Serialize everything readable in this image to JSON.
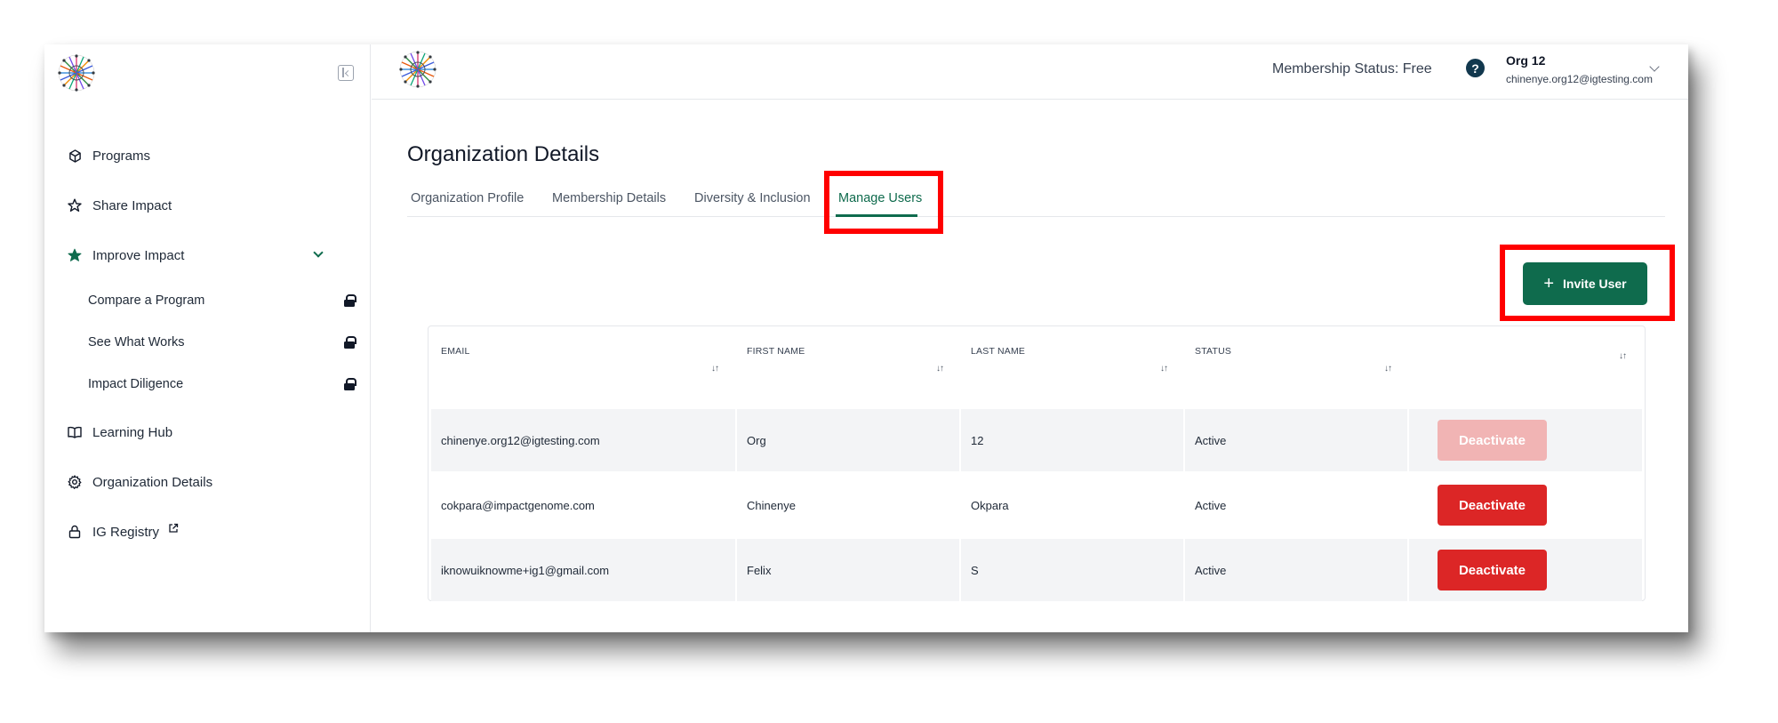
{
  "sidebar": {
    "items": [
      {
        "label": "Programs",
        "icon": "cube-icon"
      },
      {
        "label": "Share Impact",
        "icon": "star-outline-icon"
      },
      {
        "label": "Improve Impact",
        "icon": "star-filled-icon"
      },
      {
        "label": "Learning Hub",
        "icon": "book-icon"
      },
      {
        "label": "Organization Details",
        "icon": "gear-icon"
      },
      {
        "label": "IG Registry",
        "icon": "lock-outline-icon"
      }
    ],
    "subitems": [
      {
        "label": "Compare a Program",
        "icon": "lock-icon"
      },
      {
        "label": "See What Works",
        "icon": "lock-icon"
      },
      {
        "label": "Impact Diligence",
        "icon": "lock-icon"
      }
    ]
  },
  "header": {
    "membership_status": "Membership Status: Free",
    "help": "?",
    "user_name": "Org 12",
    "user_email": "chinenye.org12@igtesting.com"
  },
  "main": {
    "title": "Organization Details",
    "tabs": [
      {
        "label": "Organization Profile"
      },
      {
        "label": "Membership Details"
      },
      {
        "label": "Diversity & Inclusion"
      },
      {
        "label": "Manage Users",
        "active": true
      }
    ],
    "invite_button": {
      "plus": "+",
      "label": "Invite User"
    }
  },
  "table": {
    "columns": [
      "EMAIL",
      "FIRST NAME",
      "LAST NAME",
      "STATUS"
    ],
    "sort_glyph": "↓↑",
    "rows": [
      {
        "email": "chinenye.org12@igtesting.com",
        "first": "Org",
        "last": "12",
        "status": "Active",
        "action": "Deactivate",
        "disabled": true
      },
      {
        "email": "cokpara@impactgenome.com",
        "first": "Chinenye",
        "last": "Okpara",
        "status": "Active",
        "action": "Deactivate",
        "disabled": false
      },
      {
        "email": "iknowuiknowme+ig1@gmail.com",
        "first": "Felix",
        "last": "S",
        "status": "Active",
        "action": "Deactivate",
        "disabled": false
      }
    ]
  },
  "colors": {
    "accent_green": "#0f6b4d",
    "danger_red": "#dc2626",
    "danger_disabled": "#f1b4b4",
    "highlight_red": "#ff0000"
  }
}
